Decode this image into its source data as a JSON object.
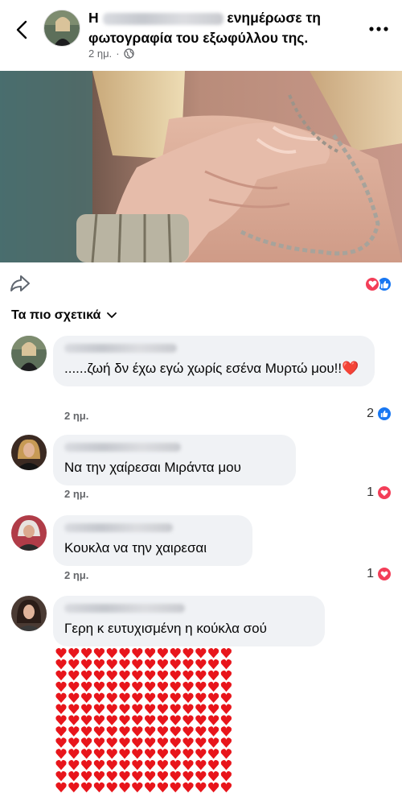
{
  "header": {
    "title_prefix": "Η",
    "title_suffix": "ενημέρωσε τη φωτογραφία του εξωφύλλου της.",
    "time": "2 ημ.",
    "back_icon": "chevron-left-icon",
    "more_icon": "more-dots-icon",
    "privacy_icon": "globe-icon"
  },
  "post": {
    "cover_alt_icon": "cover-photo"
  },
  "reactions": {
    "types": [
      "love",
      "like"
    ]
  },
  "sort": {
    "label": "Τα πιο σχετικά"
  },
  "comments": [
    {
      "text": "......ζωή δν έχω εγώ χωρίς  εσένα Μυρτώ μου!!❤️",
      "time": "2 ημ.",
      "count": "2",
      "reaction": "like"
    },
    {
      "text": "Να την χαίρεσαι Μιράντα μου",
      "time": "2 ημ.",
      "count": "1",
      "reaction": "love"
    },
    {
      "text": "Κουκλα να την χαιρεσαι",
      "time": "2 ημ.",
      "count": "1",
      "reaction": "love"
    },
    {
      "text": "Γερη κ ευτυχισμένη η κούκλα σού",
      "time": "",
      "count": "",
      "reaction": ""
    }
  ],
  "colors": {
    "bubble": "#f0f2f5",
    "love": "#f33e58",
    "like": "#1877f2",
    "heart": "#e8151b"
  }
}
